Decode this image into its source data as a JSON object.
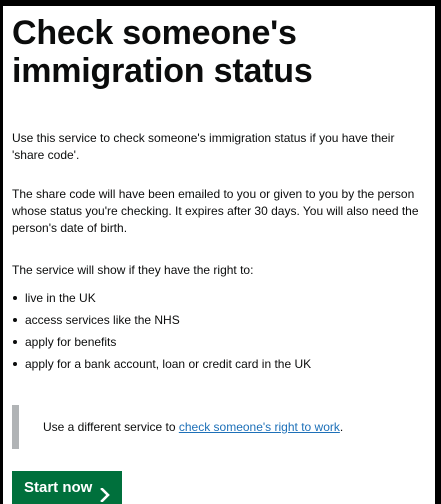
{
  "header": {
    "title": "Check someone's immigration status"
  },
  "intro": {
    "p1": "Use this service to check someone's immigration status if you have their 'share code'.",
    "p2": "The share code will have been emailed to you or given to you by the person whose status you're checking. It expires after 30 days. You will also need the person's date of birth.",
    "p3": "The service will show if they have the right to:"
  },
  "rights": [
    "live in the UK",
    "access services like the NHS",
    "apply for benefits",
    "apply for a bank account, loan or credit card in the UK"
  ],
  "inset": {
    "text": "Use a different service to ",
    "link": "check someone's right to work",
    "suffix": "."
  },
  "start_button": {
    "label": "Start now",
    "icon": "chevron-right-icon"
  },
  "colors": {
    "button": "#00703c",
    "link": "#1d70b8",
    "inset_border": "#b1b4b6",
    "text": "#0b0c0c"
  }
}
